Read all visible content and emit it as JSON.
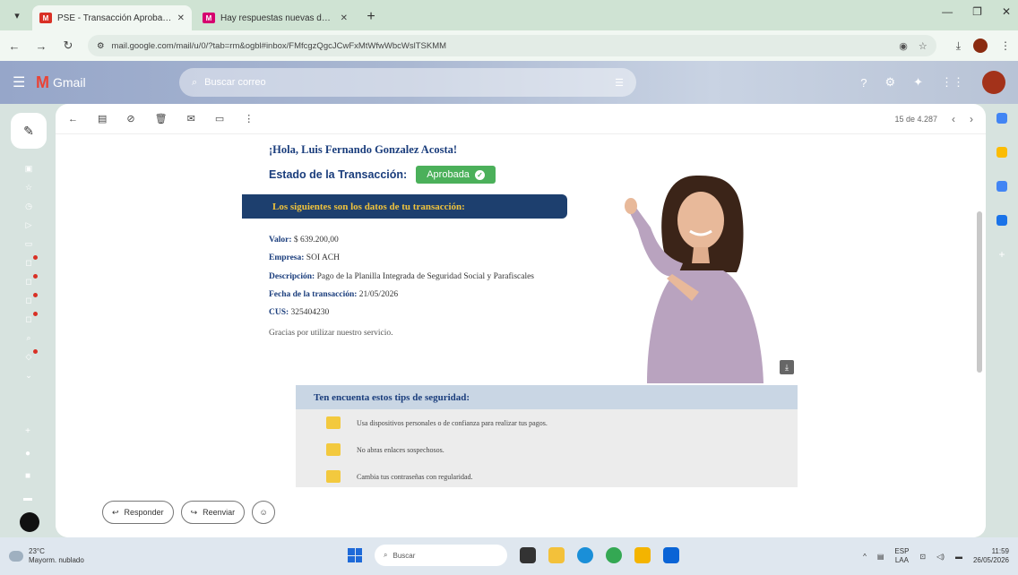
{
  "browser": {
    "tabs": [
      {
        "title": "PSE - Transacción Aprobada",
        "active": true
      },
      {
        "title": "Hay respuestas nuevas de tu LI",
        "active": false
      }
    ],
    "url": "mail.google.com/mail/u/0/?tab=rm&ogbl#inbox/FMfcgzQgcJCwFxMtWfwWbcWslTSKMM",
    "new_tab": "+"
  },
  "gmail": {
    "logo_text": "Gmail",
    "search_placeholder": "Buscar correo"
  },
  "toolbar": {
    "pagination": "15 de 4.287"
  },
  "email": {
    "greeting": "¡Hola, Luis Fernando Gonzalez Acosta!",
    "status_label": "Estado de la Transacción:",
    "status_value": "Aprobada",
    "banner": "Los siguientes son los datos de tu transacción:",
    "fields": [
      {
        "label": "Valor:",
        "value": "$ 639.200,00"
      },
      {
        "label": "Empresa:",
        "value": "SOI ACH"
      },
      {
        "label": "Descripción:",
        "value": "Pago de la Planilla Integrada de Seguridad Social y Parafiscales"
      },
      {
        "label": "Fecha de la transacción:",
        "value": "21/05/2026"
      },
      {
        "label": "CUS:",
        "value": "325404230"
      }
    ],
    "thanks": "Gracias por utilizar nuestro servicio.",
    "tips_title": "Ten encuenta estos tips de seguridad:",
    "tips": [
      "Usa dispositivos personales o de confianza para realizar tus pagos.",
      "No abras enlaces sospechosos.",
      "Cambia tus contraseñas con regularidad."
    ]
  },
  "reply": {
    "reply_label": "Responder",
    "forward_label": "Reenviar"
  },
  "taskbar": {
    "weather_temp": "23°C",
    "weather_desc": "Mayorm. nublado",
    "search_placeholder": "Buscar",
    "lang_top": "ESP",
    "lang_bottom": "LAA",
    "time": "11:59",
    "date": "26/05/2026"
  },
  "colors": {
    "approved_green": "#4bb05a",
    "banner_navy": "#1d3f6e",
    "banner_text": "#f0c33c"
  }
}
